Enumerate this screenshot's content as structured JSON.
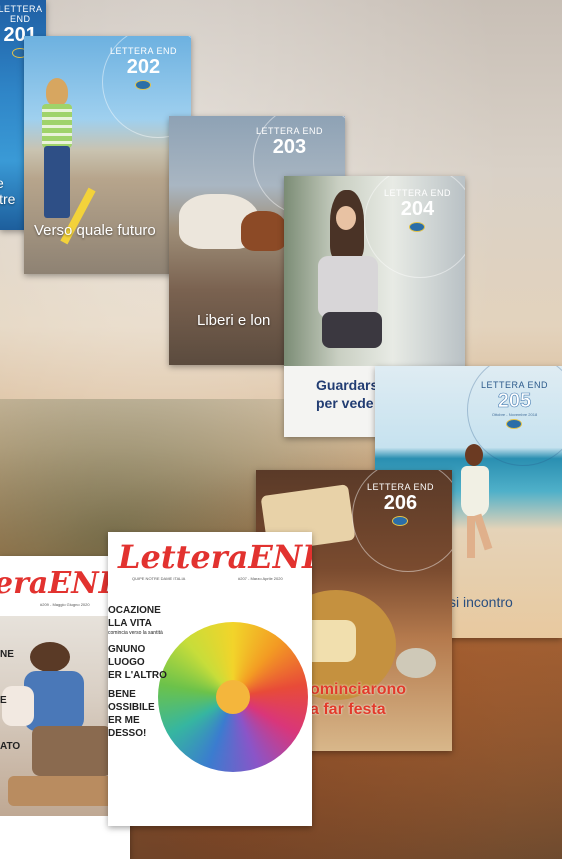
{
  "covers": [
    {
      "label": "LETTERA END",
      "number": "201",
      "headline": "e\nltre"
    },
    {
      "label": "LETTERA END",
      "number": "202",
      "headline": "Verso quale futuro"
    },
    {
      "label": "LETTERA END",
      "number": "203",
      "headline": "Liberi e lon"
    },
    {
      "label": "LETTERA END",
      "number": "204",
      "headline": "Guardarsi\nper vede"
    },
    {
      "label": "LETTERA END",
      "number": "205",
      "date": "Ottobre - Novembre 2018",
      "headline": "si incontro"
    },
    {
      "label": "LETTERA END",
      "number": "206",
      "headline": "ominciarono\na far festa"
    }
  ],
  "magazines": [
    {
      "brand": "eraEND",
      "tag": "#209 - Maggio Giugno 2020",
      "lines": [
        "NE",
        "E",
        "ATO"
      ]
    },
    {
      "brand": "LetteraEND",
      "tag": "QUIPE NOTRE DAME ITALIA",
      "issue": "#207 - Marzo Aprile 2020",
      "lines": [
        "OCAZIONE",
        "LLA VITA",
        "GNUNO",
        "LUOGO",
        "ER L'ALTRO",
        "BENE",
        "OSSIBILE",
        "ER ME",
        "DESSO!"
      ],
      "subline": "comincia verso la santità"
    }
  ]
}
